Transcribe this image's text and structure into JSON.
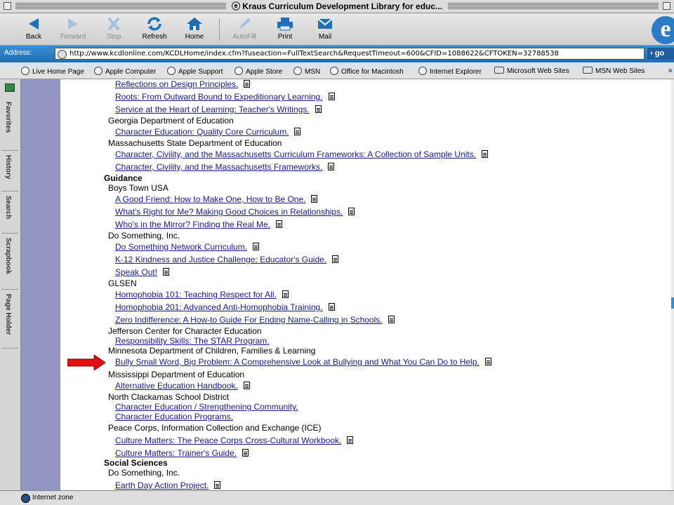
{
  "window": {
    "title": "Kraus Curriculum Development Library for educ..."
  },
  "toolbar": {
    "buttons": [
      {
        "label": "Back",
        "enabled": true
      },
      {
        "label": "Forward",
        "enabled": false
      },
      {
        "label": "Stop",
        "enabled": false
      },
      {
        "label": "Refresh",
        "enabled": true
      },
      {
        "label": "Home",
        "enabled": true
      },
      {
        "label": "AutoFill",
        "enabled": false
      },
      {
        "label": "Print",
        "enabled": true
      },
      {
        "label": "Mail",
        "enabled": true
      }
    ]
  },
  "address": {
    "label": "Address:",
    "url": "http://www.kcdlonline.com/KCDLHome/index.cfm?fuseaction=FullTextSearch&RequestTimeout=600&CFID=1088622&CFTOKEN=32788538",
    "go_label": "go"
  },
  "favorites": [
    "Live Home Page",
    "Apple Computer",
    "Apple Support",
    "Apple Store",
    "MSN",
    "Office for Macintosh",
    "Internet Explorer",
    "Microsoft Web Sites",
    "MSN Web Sites"
  ],
  "sidebar_tabs": [
    "Favorites",
    "History",
    "Search",
    "Scrapbook",
    "Page Holder"
  ],
  "lines": [
    {
      "type": "item",
      "text": "Reflections on Design Principles.",
      "doc": true
    },
    {
      "type": "item",
      "text": "Roots: From Outward Bound to Expeditionary Learning.",
      "doc": true
    },
    {
      "type": "item",
      "text": "Service at the Heart of Learning: Teacher's Writings.",
      "doc": true
    },
    {
      "type": "org",
      "text": "Georgia Department of Education"
    },
    {
      "type": "item",
      "text": "Character Education: Quality Core Curriculum.",
      "doc": true
    },
    {
      "type": "org",
      "text": "Massachusetts State Department of Education"
    },
    {
      "type": "item",
      "text": "Character, Civility, and the Massachusetts Curriculum Frameworks: A Collection of Sample Units.",
      "doc": true
    },
    {
      "type": "item",
      "text": "Character, Civility, and the Massachusetts Frameworks.",
      "doc": true
    },
    {
      "type": "cat",
      "text": "Guidance"
    },
    {
      "type": "org",
      "text": "Boys Town USA"
    },
    {
      "type": "item",
      "text": "A Good Friend: How to Make One, How to Be One.",
      "doc": true
    },
    {
      "type": "item",
      "text": "What's Right for Me? Making Good Choices in Relationships.",
      "doc": true
    },
    {
      "type": "item",
      "text": "Who's in the Mirror? Finding the Real Me.",
      "doc": true
    },
    {
      "type": "org",
      "text": "Do Something, Inc."
    },
    {
      "type": "item",
      "text": "Do Something Network Curriculum.",
      "doc": true
    },
    {
      "type": "item",
      "text": "K-12 Kindness and Justice Challenge: Educator's Guide.",
      "doc": true
    },
    {
      "type": "item",
      "text": "Speak Out!",
      "doc": true
    },
    {
      "type": "org",
      "text": "GLSEN"
    },
    {
      "type": "item",
      "text": "Homophobia 101: Teaching Respect for All.",
      "doc": true
    },
    {
      "type": "item",
      "text": "Homophobia 201: Advanced Anti-Homophobia Training.",
      "doc": true
    },
    {
      "type": "item",
      "text": "Zero Indifference: A How-to Guide For Ending Name-Calling in Schools.",
      "doc": true
    },
    {
      "type": "org",
      "text": "Jefferson Center for Character Education"
    },
    {
      "type": "item",
      "text": "Responsibility Skills: The STAR Program.",
      "doc": false
    },
    {
      "type": "org",
      "text": "Minnesota Department of Children, Families & Learning"
    },
    {
      "type": "item",
      "text": "Bully Small Word, Big Problem: A Comprehensive Look at Bullying and What You Can Do to Help.",
      "doc": true,
      "highlight": true
    },
    {
      "type": "org",
      "text": "Mississippi Department of Education"
    },
    {
      "type": "item",
      "text": "Alternative Education Handbook.",
      "doc": true
    },
    {
      "type": "org",
      "text": "North Clackamas School District"
    },
    {
      "type": "item",
      "text": "Character Education / Strengthening Community.",
      "doc": false
    },
    {
      "type": "item",
      "text": "Character Education Programs.",
      "doc": false
    },
    {
      "type": "org",
      "text": "Peace Corps, Information Collection and Exchange (ICE)"
    },
    {
      "type": "item",
      "text": "Culture Matters: The Peace Corps Cross-Cultural Workbook.",
      "doc": true
    },
    {
      "type": "item",
      "text": "Culture Matters: Trainer's Guide.",
      "doc": true
    },
    {
      "type": "cat",
      "text": "Social Sciences"
    },
    {
      "type": "org",
      "text": "Do Something, Inc."
    },
    {
      "type": "item",
      "text": "Earth Day Action Project.",
      "doc": true
    }
  ],
  "status": {
    "zone": "Internet zone"
  },
  "colors": {
    "accent": "#1e6fb5",
    "link": "#1a1a8c",
    "leftbar": "#9196c3",
    "arrow": "#e01010"
  }
}
